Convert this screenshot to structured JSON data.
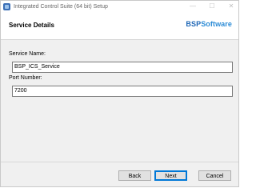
{
  "window": {
    "title": "Integrated Control Suite (64 bit) Setup",
    "controls": {
      "minimize": "—",
      "maximize": "☐",
      "close": "✕"
    }
  },
  "header": {
    "title": "Service Details",
    "brand_part1": "BSP",
    "brand_part2": "Software"
  },
  "form": {
    "service_name_label": "Service Name:",
    "service_name_value": "BSP_ICS_Service",
    "port_number_label": "Port Number:",
    "port_number_value": "7200"
  },
  "buttons": {
    "back": "Back",
    "next": "Next",
    "cancel": "Cancel"
  },
  "colors": {
    "brand_dark": "#1f67b6",
    "brand_light": "#2b8bd6",
    "focus_border": "#0078d7"
  }
}
